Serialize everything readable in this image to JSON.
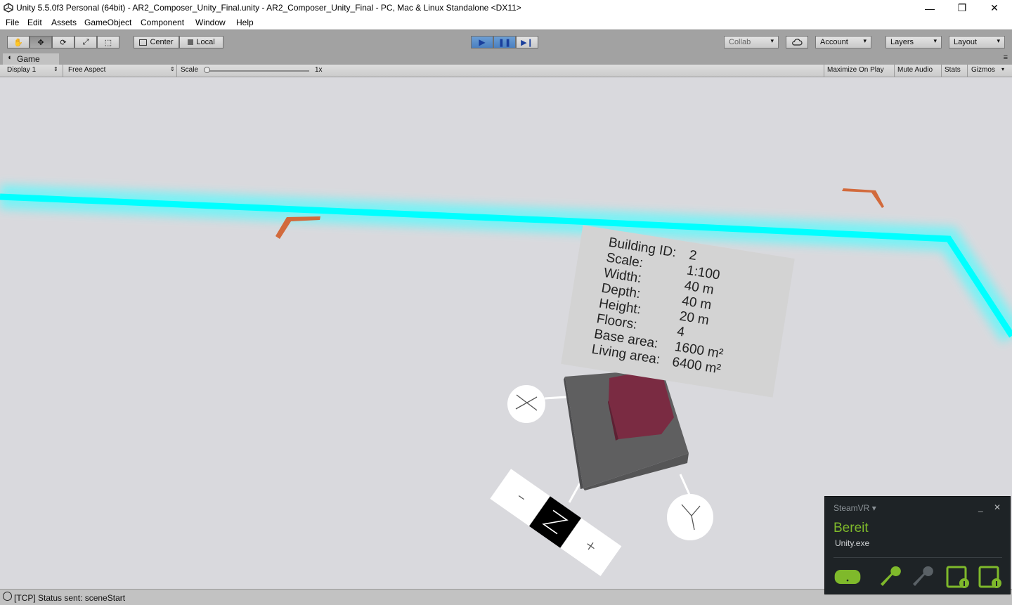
{
  "window": {
    "title": "Unity 5.5.0f3 Personal (64bit) - AR2_Composer_Unity_Final.unity - AR2_Composer_Unity_Final - PC, Mac & Linux Standalone <DX11>",
    "controls": {
      "minimize": "—",
      "restore": "❐",
      "close": "✕"
    }
  },
  "menu": {
    "items": [
      "File",
      "Edit",
      "Assets",
      "GameObject",
      "Component",
      "Window",
      "Help"
    ]
  },
  "toolbar": {
    "tools": [
      {
        "name": "hand-tool",
        "icon": "hand-icon",
        "glyph": "✋"
      },
      {
        "name": "move-tool",
        "icon": "move-icon",
        "glyph": "✥"
      },
      {
        "name": "rotate-tool",
        "icon": "rotate-icon",
        "glyph": "⟳"
      },
      {
        "name": "scale-tool",
        "icon": "scale-icon",
        "glyph": "⤢"
      },
      {
        "name": "rect-tool",
        "icon": "rect-icon",
        "glyph": "⬚"
      }
    ],
    "active_tool": "move-tool",
    "pivot_label": "Center",
    "space_label": "Local",
    "playback": {
      "play": "▶",
      "pause": "❚❚",
      "step": "▶❙",
      "playing": true,
      "paused": true
    },
    "collab_label": "Collab",
    "account_label": "Account",
    "layers_label": "Layers",
    "layout_label": "Layout",
    "dropdown_arrow": "▾"
  },
  "game_tab": {
    "label": "Game"
  },
  "game_bar": {
    "display": "Display 1",
    "aspect": "Free Aspect",
    "scale_label": "Scale",
    "scale_value": "1x",
    "toggles": [
      "Maximize On Play",
      "Mute Audio",
      "Stats",
      "Gizmos"
    ]
  },
  "scene": {
    "info_panel": {
      "rows": [
        {
          "label": "Building ID:",
          "value": "2"
        },
        {
          "label": "Scale:",
          "value": "1:100"
        },
        {
          "label": "Width:",
          "value": "40 m"
        },
        {
          "label": "Depth:",
          "value": "40 m"
        },
        {
          "label": "Height:",
          "value": "20 m"
        },
        {
          "label": "Floors:",
          "value": "4"
        },
        {
          "label": "Base area:",
          "value": "1600 m²"
        },
        {
          "label": "Living area:",
          "value": "6400 m²"
        }
      ]
    },
    "gizmo_labels": {
      "x_axis": "X",
      "y_axis": "Y",
      "z_axis": "Z",
      "minus": "-",
      "plus": "+"
    },
    "colors": {
      "background": "#d9d9dd",
      "boundary_glow": "#00ffff",
      "corner_marker": "#d06a3a",
      "building_base": "#5f5f60",
      "building_top": "#7a2b42"
    }
  },
  "steamvr": {
    "header": "SteamVR",
    "status": "Bereit",
    "app": "Unity.exe",
    "minimize": "_",
    "close": "✕",
    "status_color": "#7fb92b"
  },
  "status_bar": {
    "message": "[TCP] Status sent: sceneStart"
  }
}
